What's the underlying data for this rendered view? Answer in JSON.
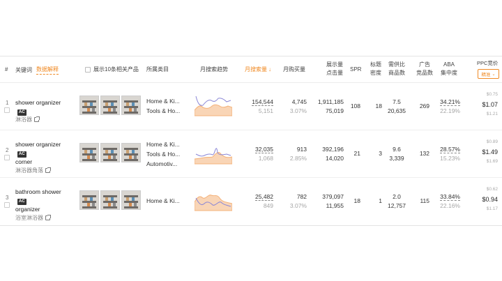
{
  "header": {
    "index": "#",
    "keyword": "关键词",
    "data_interpret": "数据解释",
    "show_top10": "展示10条相关产品",
    "category": "所属类目",
    "trend": "月搜索趋势",
    "monthly_search": "月搜索量",
    "monthly_purchase": "月购买量",
    "impressions": "展示量",
    "clicks": "点击量",
    "spr": "SPR",
    "title_density_1": "标题",
    "title_density_2": "密度",
    "supply_demand_1": "需供比",
    "supply_demand_2": "商品数",
    "ad_1": "广告",
    "ad_2": "竞品数",
    "aba_1": "ABA",
    "aba_2": "集中度",
    "ppc": "PPC竞价",
    "ppc_mode": "精准"
  },
  "colors": {
    "accent": "#f08a24",
    "trend_orange": "#f4b27a",
    "trend_purple": "#8a86d6"
  },
  "rows": [
    {
      "index": "1",
      "keyword_line1": "shower organizer",
      "keyword_line2": "",
      "badge": "AC",
      "keyword_cn": "淋浴器",
      "categories": [
        "Home & Ki...",
        "Tools & Ho..."
      ],
      "monthly_search": "154,544",
      "monthly_search_sub": "5,151",
      "monthly_purchase": "4,745",
      "monthly_purchase_pct": "3.07%",
      "impressions": "1,911,185",
      "clicks": "75,019",
      "spr": "108",
      "title_density": "18",
      "supply_demand": "7.5",
      "products": "20,635",
      "ad_products": "269",
      "aba": "34.21%",
      "aba_sub": "22.19%",
      "ppc_low": "$0.75",
      "ppc_mid": "$1.07",
      "ppc_high": "$1.21"
    },
    {
      "index": "2",
      "keyword_line1": "shower organizer",
      "keyword_line2": "corner",
      "badge": "AC",
      "keyword_cn": "淋浴器角落",
      "categories": [
        "Home & Ki...",
        "Tools & Ho...",
        "Automotiv..."
      ],
      "monthly_search": "32,035",
      "monthly_search_sub": "1,068",
      "monthly_purchase": "913",
      "monthly_purchase_pct": "2.85%",
      "impressions": "392,196",
      "clicks": "14,020",
      "spr": "21",
      "title_density": "3",
      "supply_demand": "9.6",
      "products": "3,339",
      "ad_products": "132",
      "aba": "28.57%",
      "aba_sub": "15.23%",
      "ppc_low": "$0.89",
      "ppc_mid": "$1.49",
      "ppc_high": "$1.69"
    },
    {
      "index": "3",
      "keyword_line1": "bathroom shower",
      "keyword_line2": "organizer",
      "badge": "AC",
      "keyword_cn": "浴室淋浴器",
      "categories": [
        "Home & Ki..."
      ],
      "monthly_search": "25,482",
      "monthly_search_sub": "849",
      "monthly_purchase": "782",
      "monthly_purchase_pct": "3.07%",
      "impressions": "379,097",
      "clicks": "11,955",
      "spr": "18",
      "title_density": "1",
      "supply_demand": "2.0",
      "products": "12,757",
      "ad_products": "115",
      "aba": "33.84%",
      "aba_sub": "22.16%",
      "ppc_low": "$0.62",
      "ppc_mid": "$0.94",
      "ppc_high": "$1.17"
    }
  ]
}
